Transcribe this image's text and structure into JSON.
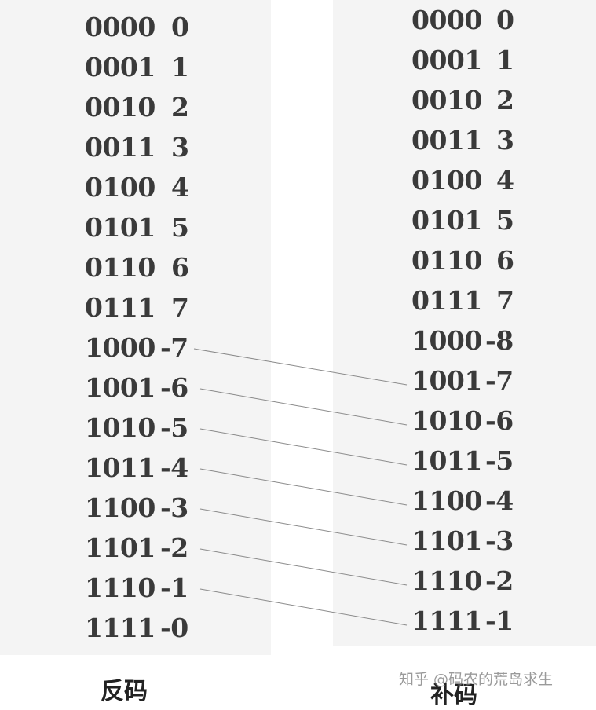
{
  "left_table": {
    "caption": "反码",
    "rows": [
      {
        "bin": "0000",
        "dec": "0"
      },
      {
        "bin": "0001",
        "dec": "1"
      },
      {
        "bin": "0010",
        "dec": "2"
      },
      {
        "bin": "0011",
        "dec": "3"
      },
      {
        "bin": "0100",
        "dec": "4"
      },
      {
        "bin": "0101",
        "dec": "5"
      },
      {
        "bin": "0110",
        "dec": "6"
      },
      {
        "bin": "0111",
        "dec": "7"
      },
      {
        "bin": "1000",
        "dec": "-7"
      },
      {
        "bin": "1001",
        "dec": "-6"
      },
      {
        "bin": "1010",
        "dec": "-5"
      },
      {
        "bin": "1011",
        "dec": "-4"
      },
      {
        "bin": "1100",
        "dec": "-3"
      },
      {
        "bin": "1101",
        "dec": "-2"
      },
      {
        "bin": "1110",
        "dec": "-1"
      },
      {
        "bin": "1111",
        "dec": "-0"
      }
    ]
  },
  "right_table": {
    "caption": "补码",
    "rows": [
      {
        "bin": "0000",
        "dec": "0"
      },
      {
        "bin": "0001",
        "dec": "1"
      },
      {
        "bin": "0010",
        "dec": "2"
      },
      {
        "bin": "0011",
        "dec": "3"
      },
      {
        "bin": "0100",
        "dec": "4"
      },
      {
        "bin": "0101",
        "dec": "5"
      },
      {
        "bin": "0110",
        "dec": "6"
      },
      {
        "bin": "0111",
        "dec": "7"
      },
      {
        "bin": "1000",
        "dec": "-8"
      },
      {
        "bin": "1001",
        "dec": "-7"
      },
      {
        "bin": "1010",
        "dec": "-6"
      },
      {
        "bin": "1011",
        "dec": "-5"
      },
      {
        "bin": "1100",
        "dec": "-4"
      },
      {
        "bin": "1101",
        "dec": "-3"
      },
      {
        "bin": "1110",
        "dec": "-2"
      },
      {
        "bin": "1111",
        "dec": "-1"
      }
    ]
  },
  "connections": [
    {
      "from": "-7",
      "to": "-7"
    },
    {
      "from": "-6",
      "to": "-6"
    },
    {
      "from": "-5",
      "to": "-5"
    },
    {
      "from": "-4",
      "to": "-4"
    },
    {
      "from": "-3",
      "to": "-3"
    },
    {
      "from": "-2",
      "to": "-2"
    },
    {
      "from": "-1",
      "to": "-1"
    }
  ],
  "watermark": "知乎 @码农的荒岛求生",
  "colors": {
    "panel": "#f4f4f4",
    "text": "#3a3a3a",
    "line": "#8a8a8a"
  }
}
